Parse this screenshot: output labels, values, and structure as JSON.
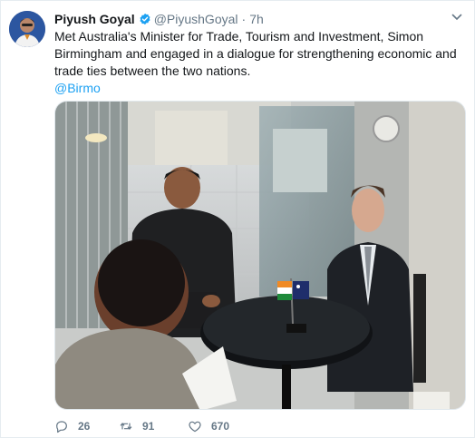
{
  "tweet": {
    "author_name": "Piyush Goyal",
    "handle": "@PiyushGoyal",
    "separator": "·",
    "time": "7h",
    "text": "Met Australia's Minister for Trade, Tourism and Investment, Simon Birmingham and engaged in a dialogue for strengthening economic and trade ties between the two nations.",
    "mention": "@Birmo",
    "verified": true
  },
  "actions": {
    "reply_count": "26",
    "retweet_count": "91",
    "like_count": "670"
  },
  "colors": {
    "link": "#1da1f2",
    "secondary_text": "#657786",
    "verified_badge": "#1da1f2"
  },
  "icons": {
    "reply": "comment-bubble-icon",
    "retweet": "retweet-arrows-icon",
    "like": "heart-icon",
    "menu": "chevron-down-icon",
    "verified": "verified-badge-icon"
  }
}
